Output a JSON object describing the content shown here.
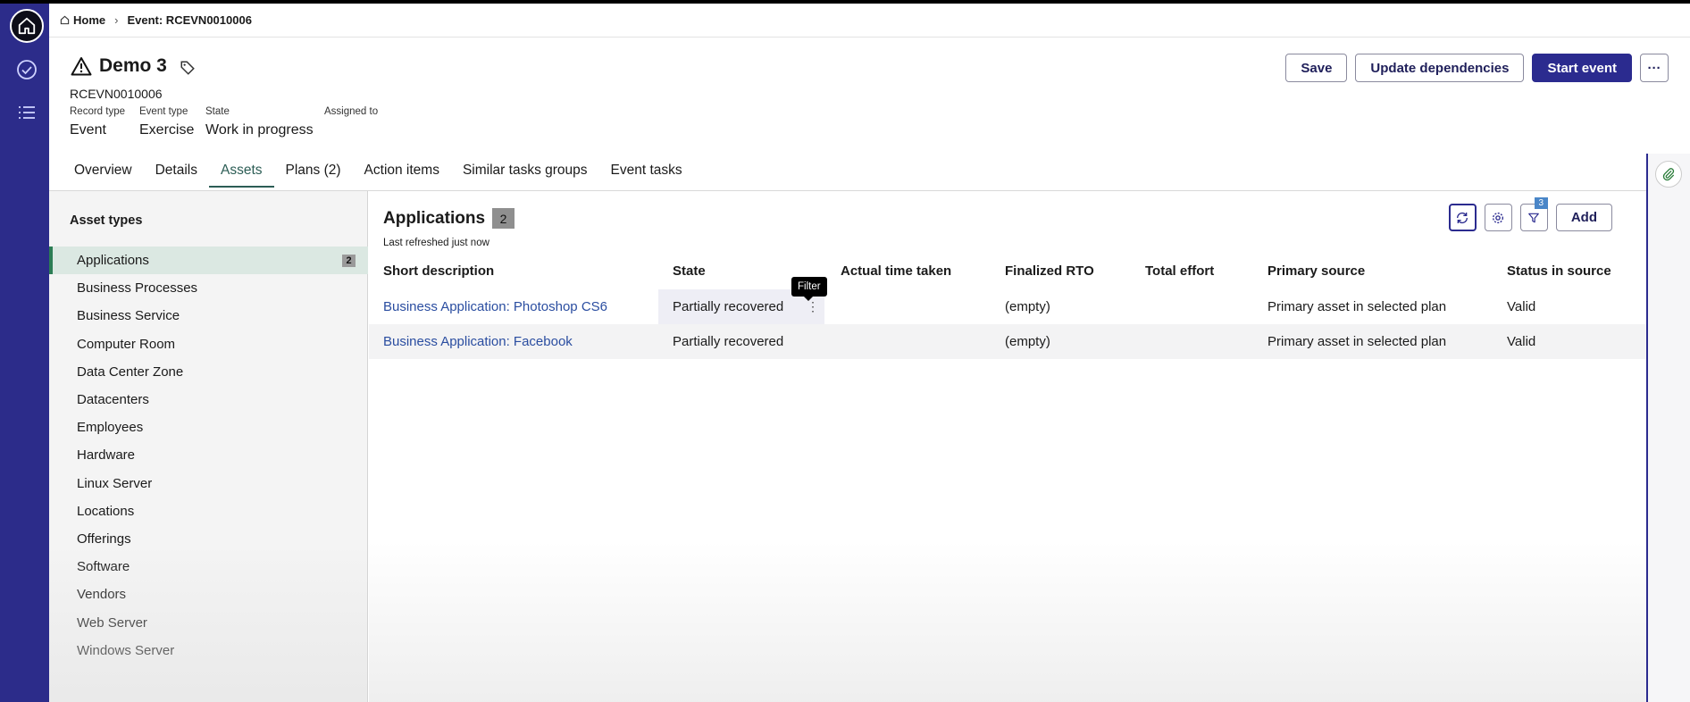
{
  "breadcrumb": {
    "home": "Home",
    "current": "Event: RCEVN0010006"
  },
  "record": {
    "title": "Demo 3",
    "number": "RCEVN0010006",
    "fields": [
      {
        "label": "Record type",
        "value": "Event"
      },
      {
        "label": "Event type",
        "value": "Exercise"
      },
      {
        "label": "State",
        "value": "Work in progress"
      },
      {
        "label": "Assigned to",
        "value": ""
      }
    ]
  },
  "actions": {
    "save": "Save",
    "update": "Update dependencies",
    "start": "Start event",
    "more": "···"
  },
  "tabs": [
    "Overview",
    "Details",
    "Assets",
    "Plans (2)",
    "Action items",
    "Similar tasks groups",
    "Event tasks"
  ],
  "active_tab": "Assets",
  "asset_types": {
    "heading": "Asset types",
    "items": [
      {
        "label": "Applications",
        "count": "2"
      },
      {
        "label": "Business Processes"
      },
      {
        "label": "Business Service"
      },
      {
        "label": "Computer Room"
      },
      {
        "label": "Data Center Zone"
      },
      {
        "label": "Datacenters"
      },
      {
        "label": "Employees"
      },
      {
        "label": "Hardware"
      },
      {
        "label": "Linux Server"
      },
      {
        "label": "Locations"
      },
      {
        "label": "Offerings"
      },
      {
        "label": "Software"
      },
      {
        "label": "Vendors"
      },
      {
        "label": "Web Server"
      },
      {
        "label": "Windows Server"
      }
    ]
  },
  "list": {
    "title": "Applications",
    "count": "2",
    "refreshed": "Last refreshed just now",
    "filter_count": "3",
    "add": "Add",
    "tooltip": "Filter",
    "columns": [
      "Short description",
      "State",
      "Actual time taken",
      "Finalized RTO",
      "Total effort",
      "Primary source",
      "Status in source"
    ],
    "rows": [
      [
        "Business Application: Photoshop CS6",
        "Partially recovered",
        "",
        "(empty)",
        "",
        "Primary asset in selected plan",
        "Valid"
      ],
      [
        "Business Application: Facebook",
        "Partially recovered",
        "",
        "(empty)",
        "",
        "Primary asset in selected plan",
        "Valid"
      ]
    ]
  }
}
